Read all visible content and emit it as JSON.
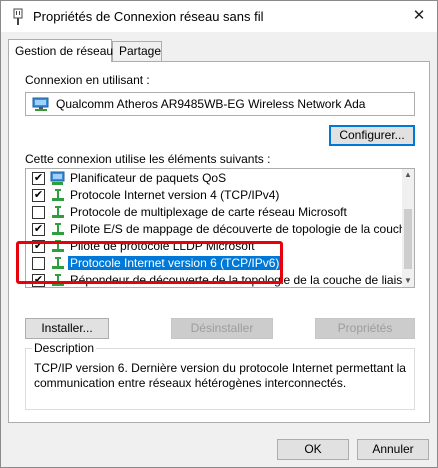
{
  "window": {
    "title": "Propriétés de Connexion réseau sans fil",
    "close_glyph": "✕"
  },
  "tabs": [
    {
      "label": "Gestion de réseau"
    },
    {
      "label": "Partage"
    }
  ],
  "connection": {
    "label": "Connexion en utilisant :",
    "adapter": "Qualcomm Atheros AR9485WB-EG Wireless Network Ada",
    "configure_button": "Configurer..."
  },
  "components": {
    "label": "Cette connexion utilise les éléments suivants :",
    "items": [
      {
        "label": "Planificateur de paquets QoS",
        "checked": "✔",
        "icon": "qos-icon"
      },
      {
        "label": "Protocole Internet version 4 (TCP/IPv4)",
        "checked": "✔",
        "icon": "protocol-icon"
      },
      {
        "label": "Protocole de multiplexage de carte réseau Microsoft",
        "checked": "",
        "icon": "protocol-icon"
      },
      {
        "label": "Pilote E/S de mappage de découverte de topologie de la couche de liais",
        "checked": "✔",
        "icon": "protocol-icon"
      },
      {
        "label": "Pilote de protocole LLDP Microsoft",
        "checked": "✔",
        "icon": "protocol-icon"
      },
      {
        "label": "Protocole Internet version 6 (TCP/IPv6)",
        "checked": "",
        "icon": "protocol-icon"
      },
      {
        "label": "Répondeur de découverte de la topologie de la couche de liaison",
        "checked": "✔",
        "icon": "protocol-icon"
      }
    ],
    "selected_index": 5
  },
  "buttons": {
    "install": "Installer...",
    "uninstall": "Désinstaller",
    "properties": "Propriétés",
    "ok": "OK",
    "cancel": "Annuler"
  },
  "description": {
    "title": "Description",
    "text": "TCP/IP version 6. Dernière version du protocole Internet permettant la communication entre réseaux hétérogènes interconnectés."
  },
  "colors": {
    "selection": "#0078d7",
    "highlight_box": "#e8000b",
    "protocol_icon": "#2e9e3e"
  }
}
